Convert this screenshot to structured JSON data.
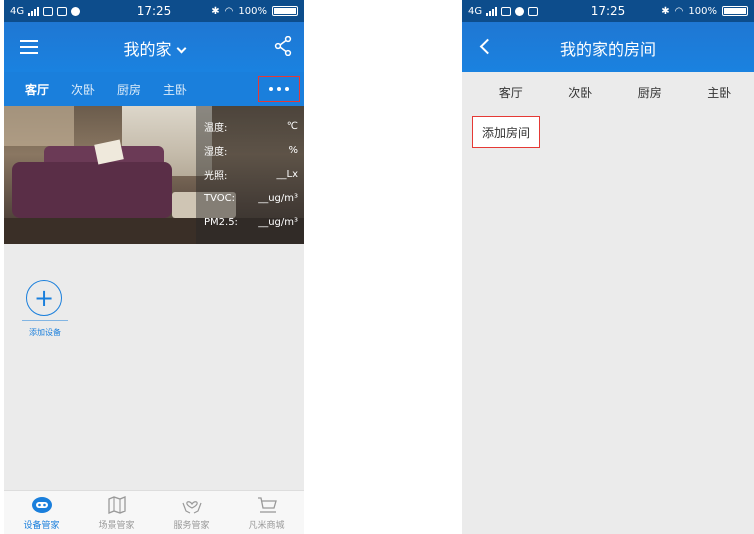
{
  "left_screen": {
    "status_bar": {
      "network": "4G",
      "time": "17:25",
      "battery": "100%"
    },
    "header": {
      "title": "我的家"
    },
    "tabs": [
      {
        "label": "客厅"
      },
      {
        "label": "次卧"
      },
      {
        "label": "厨房"
      },
      {
        "label": "主卧"
      }
    ],
    "sensor_readings": [
      {
        "label": "温度:",
        "unit": "℃"
      },
      {
        "label": "湿度:",
        "unit": "%"
      },
      {
        "label": "光照:",
        "unit": "__Lx"
      },
      {
        "label": "TVOC:",
        "unit": "__ug/m³"
      },
      {
        "label": "PM2.5:",
        "unit": "__ug/m³"
      }
    ],
    "add_device_label": "添加设备",
    "bottom_nav": [
      {
        "label": "设备管家",
        "icon": "robot-icon",
        "active": true
      },
      {
        "label": "场景管家",
        "icon": "map-icon",
        "active": false
      },
      {
        "label": "服务管家",
        "icon": "hands-heart-icon",
        "active": false
      },
      {
        "label": "凡米商城",
        "icon": "cart-icon",
        "active": false
      }
    ]
  },
  "right_screen": {
    "status_bar": {
      "network": "4G",
      "time": "17:25",
      "battery": "100%"
    },
    "header": {
      "title": "我的家的房间"
    },
    "tabs": [
      {
        "label": "客厅"
      },
      {
        "label": "次卧"
      },
      {
        "label": "厨房"
      },
      {
        "label": "主卧"
      }
    ],
    "add_room_label": "添加房间"
  },
  "colors": {
    "primary": "#1a7fdc",
    "status_bar": "#0d4d8c",
    "highlight": "#e53935",
    "background": "#ebebeb"
  }
}
